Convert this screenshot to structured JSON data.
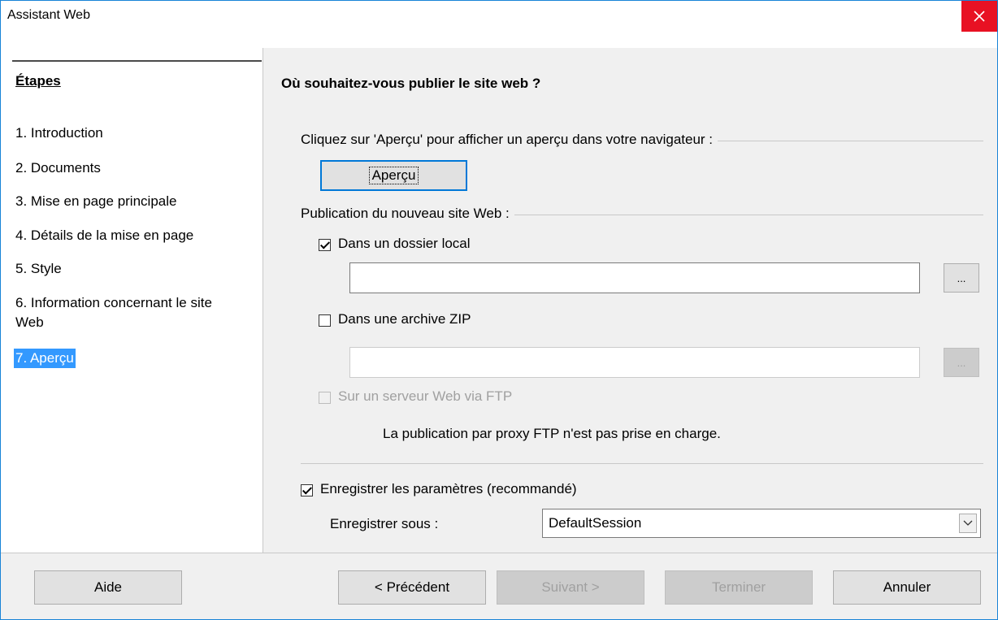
{
  "window": {
    "title": "Assistant Web"
  },
  "sidebar": {
    "heading": "Étapes",
    "steps": [
      {
        "label": "1. Introduction"
      },
      {
        "label": "2. Documents"
      },
      {
        "label": "3. Mise en page principale"
      },
      {
        "label": "4. Détails de la mise en page"
      },
      {
        "label": "5. Style"
      },
      {
        "label": "6. Information concernant le site Web"
      },
      {
        "label": "7. Aperçu",
        "selected": true
      }
    ]
  },
  "main": {
    "heading": "Où souhaitez-vous publier le site web ?",
    "preview_group_label": "Cliquez sur 'Aperçu' pour afficher un aperçu dans votre navigateur :",
    "preview_button": "Aperçu",
    "publish_group_label": "Publication du nouveau site Web :",
    "local_folder": {
      "label": "Dans un dossier local",
      "checked": true,
      "value": "",
      "browse": "..."
    },
    "zip_archive": {
      "label": "Dans une archive ZIP",
      "checked": false,
      "value": "",
      "browse": "..."
    },
    "ftp": {
      "label": "Sur un serveur Web via FTP",
      "checked": false,
      "disabled": true
    },
    "ftp_note": "La publication par proxy FTP n'est pas prise en charge.",
    "save_settings": {
      "label": "Enregistrer les paramètres (recommandé)",
      "checked": true
    },
    "save_as_label": "Enregistrer sous :",
    "save_as_value": "DefaultSession"
  },
  "footer": {
    "help": "Aide",
    "previous": "< Précédent",
    "next": "Suivant >",
    "finish": "Terminer",
    "cancel": "Annuler"
  },
  "colors": {
    "accent": "#0078d7",
    "close": "#e81123",
    "selection": "#3399ff"
  }
}
